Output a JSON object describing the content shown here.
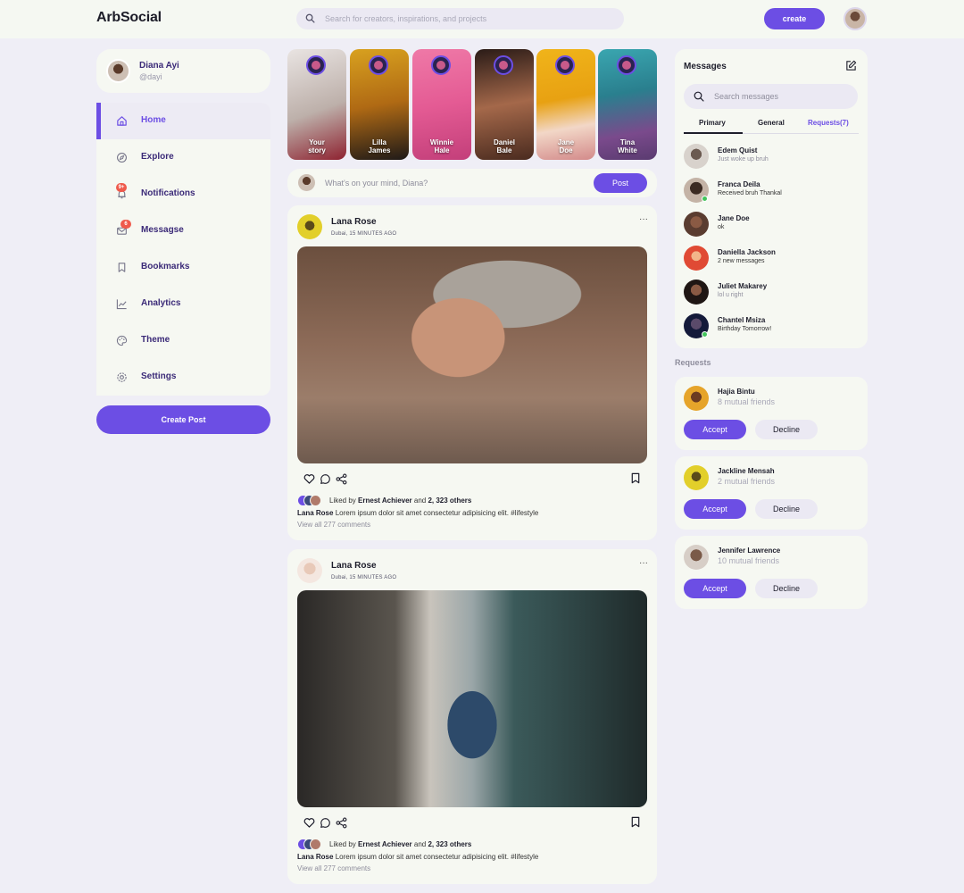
{
  "app": {
    "title": "ArbSocial"
  },
  "header": {
    "search_placeholder": "Search for creators, inspirations, and projects",
    "create_label": "create"
  },
  "profile": {
    "name": "Diana Ayi",
    "handle": "@dayi"
  },
  "sidebar": {
    "items": [
      {
        "label": "Home",
        "icon": "home-icon",
        "active": true
      },
      {
        "label": "Explore",
        "icon": "compass-icon"
      },
      {
        "label": "Notifications",
        "icon": "bell-icon",
        "badge": "9+"
      },
      {
        "label": "Messagse",
        "icon": "mail-icon",
        "badge": "6"
      },
      {
        "label": "Bookmarks",
        "icon": "bookmark-icon"
      },
      {
        "label": "Analytics",
        "icon": "chart-icon"
      },
      {
        "label": "Theme",
        "icon": "palette-icon"
      },
      {
        "label": "Settings",
        "icon": "gear-icon"
      }
    ],
    "create_post_label": "Create Post"
  },
  "stories": [
    {
      "name_line1": "Your",
      "name_line2": "story"
    },
    {
      "name_line1": "Lilla",
      "name_line2": "James"
    },
    {
      "name_line1": "Winnie",
      "name_line2": "Hale"
    },
    {
      "name_line1": "Daniel",
      "name_line2": "Bale"
    },
    {
      "name_line1": "Jane",
      "name_line2": "Doe"
    },
    {
      "name_line1": "Tina",
      "name_line2": "White"
    }
  ],
  "composer": {
    "placeholder": "What's on your mind, Diana?",
    "post_label": "Post"
  },
  "feed": [
    {
      "author": "Lana Rose",
      "location": "Dubai, 15 MINUTES AGO",
      "more": "···",
      "liked_prefix": "Liked by ",
      "liked_by": "Ernest Achiever",
      "liked_and": " and ",
      "liked_others": "2, 323 others",
      "caption_author": "Lana Rose",
      "caption_text": " Lorem ipsum dolor sit amet consectetur adipisicing elit. #lifestyle",
      "comments": "View all 277 comments"
    },
    {
      "author": "Lana Rose",
      "location": "Dubai, 15 MINUTES AGO",
      "more": "···",
      "liked_prefix": "Liked by ",
      "liked_by": "Ernest Achiever",
      "liked_and": " and ",
      "liked_others": "2, 323 others",
      "caption_author": "Lana Rose",
      "caption_text": " Lorem ipsum dolor sit amet consectetur adipisicing elit. #lifestyle",
      "comments": "View all 277 comments"
    }
  ],
  "messages": {
    "title": "Messages",
    "search_placeholder": "Search messages",
    "tabs": [
      "Primary",
      "General",
      "Requests(7)"
    ],
    "list": [
      {
        "name": "Edem Quist",
        "text": "Just woke up bruh",
        "dim": true
      },
      {
        "name": "Franca Deila",
        "text": "Received bruh Thankal",
        "online": true
      },
      {
        "name": "Jane Doe",
        "text": "ok"
      },
      {
        "name": "Daniella Jackson",
        "text": "2 new messages"
      },
      {
        "name": "Juliet Makarey",
        "text": "lol u right",
        "dim": true
      },
      {
        "name": "Chantel Msiza",
        "text": "Birthday Tomorrow!",
        "online": true
      }
    ]
  },
  "requests": {
    "title": "Requests",
    "accept_label": "Accept",
    "decline_label": "Decline",
    "list": [
      {
        "name": "Hajia Bintu",
        "mutual": "8 mutual friends"
      },
      {
        "name": "Jackline Mensah",
        "mutual": "2 mutual friends"
      },
      {
        "name": "Jennifer Lawrence",
        "mutual": "10 mutual friends"
      }
    ]
  },
  "colors": {
    "accent": "#6c4ee4",
    "badge": "#ef5a4c",
    "online": "#43c45c"
  }
}
